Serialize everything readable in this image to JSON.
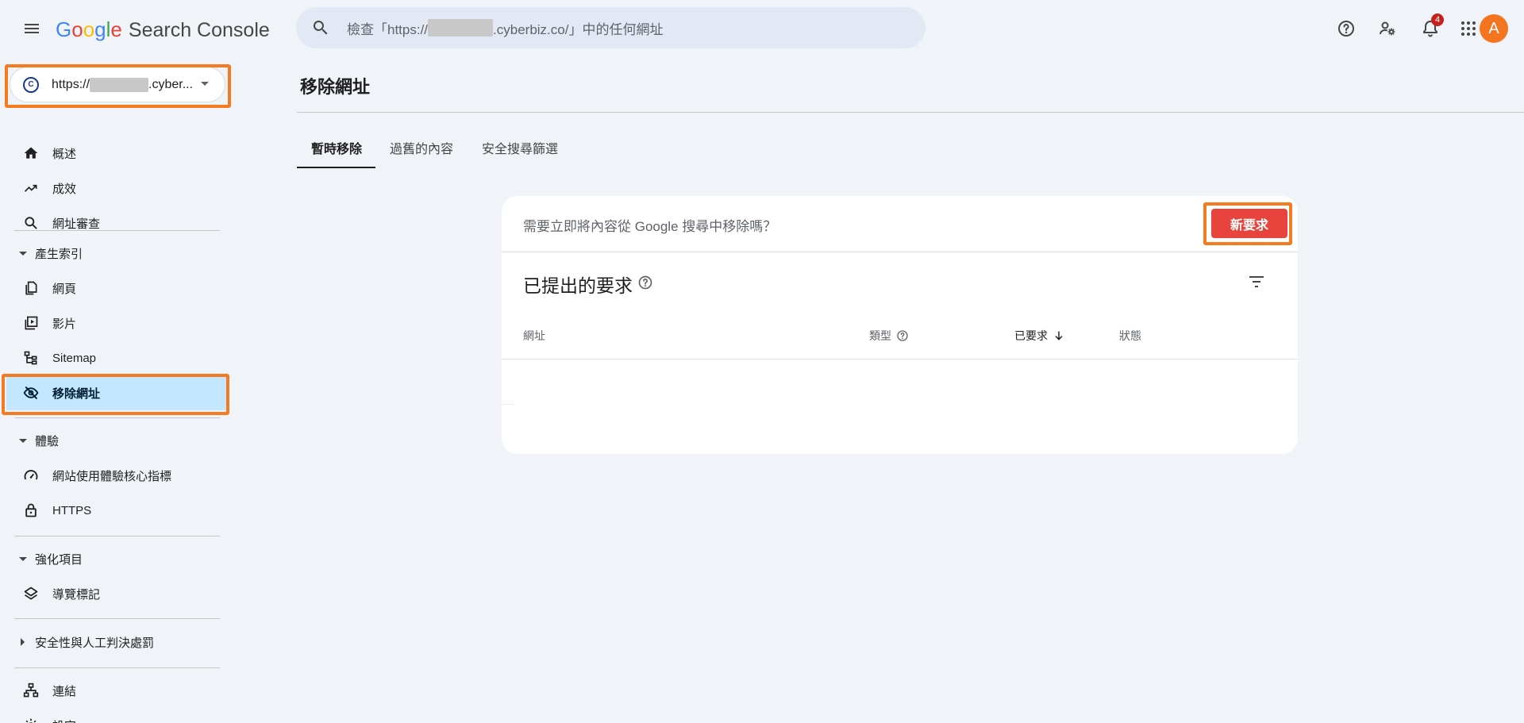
{
  "header": {
    "logo_letters": [
      "G",
      "o",
      "o",
      "g",
      "l",
      "e"
    ],
    "product_name": "Search Console",
    "search_placeholder_prefix": "檢查「https://",
    "search_placeholder_suffix": ".cyberbiz.co/」中的任何網址",
    "notifications_count": "4",
    "avatar_letter": "A",
    "icons": [
      "menu-icon",
      "search-icon",
      "help-icon",
      "manage-users-icon",
      "notifications-icon",
      "apps-icon"
    ]
  },
  "property": {
    "url_prefix": "https://",
    "url_suffix": ".cyber...",
    "favicon_text": "C"
  },
  "sidebar": {
    "overview": "概述",
    "performance": "成效",
    "url_inspection": "網址審查",
    "indexing_section": "產生索引",
    "pages": "網頁",
    "videos": "影片",
    "sitemaps": "Sitemap",
    "removals": "移除網址",
    "experience_section": "體驗",
    "core_web_vitals": "網站使用體驗核心指標",
    "https": "HTTPS",
    "enhancements_section": "強化項目",
    "breadcrumbs": "導覽標記",
    "security_section": "安全性與人工判決處罰",
    "links": "連結",
    "settings": "設定"
  },
  "main": {
    "page_title": "移除網址",
    "tabs": [
      "暫時移除",
      "過舊的內容",
      "安全搜尋篩選"
    ],
    "prompt_text": "需要立即將內容從 Google 搜尋中移除嗎？",
    "new_request_label": "新要求",
    "submitted_title": "已提出的要求",
    "columns": [
      "網址",
      "類型",
      "已要求",
      "狀態"
    ]
  },
  "colors": {
    "accent_orange": "#f47b20",
    "new_request_red": "#e8433c",
    "active_nav": "#c2e7ff",
    "avatar": "#f4751f"
  }
}
